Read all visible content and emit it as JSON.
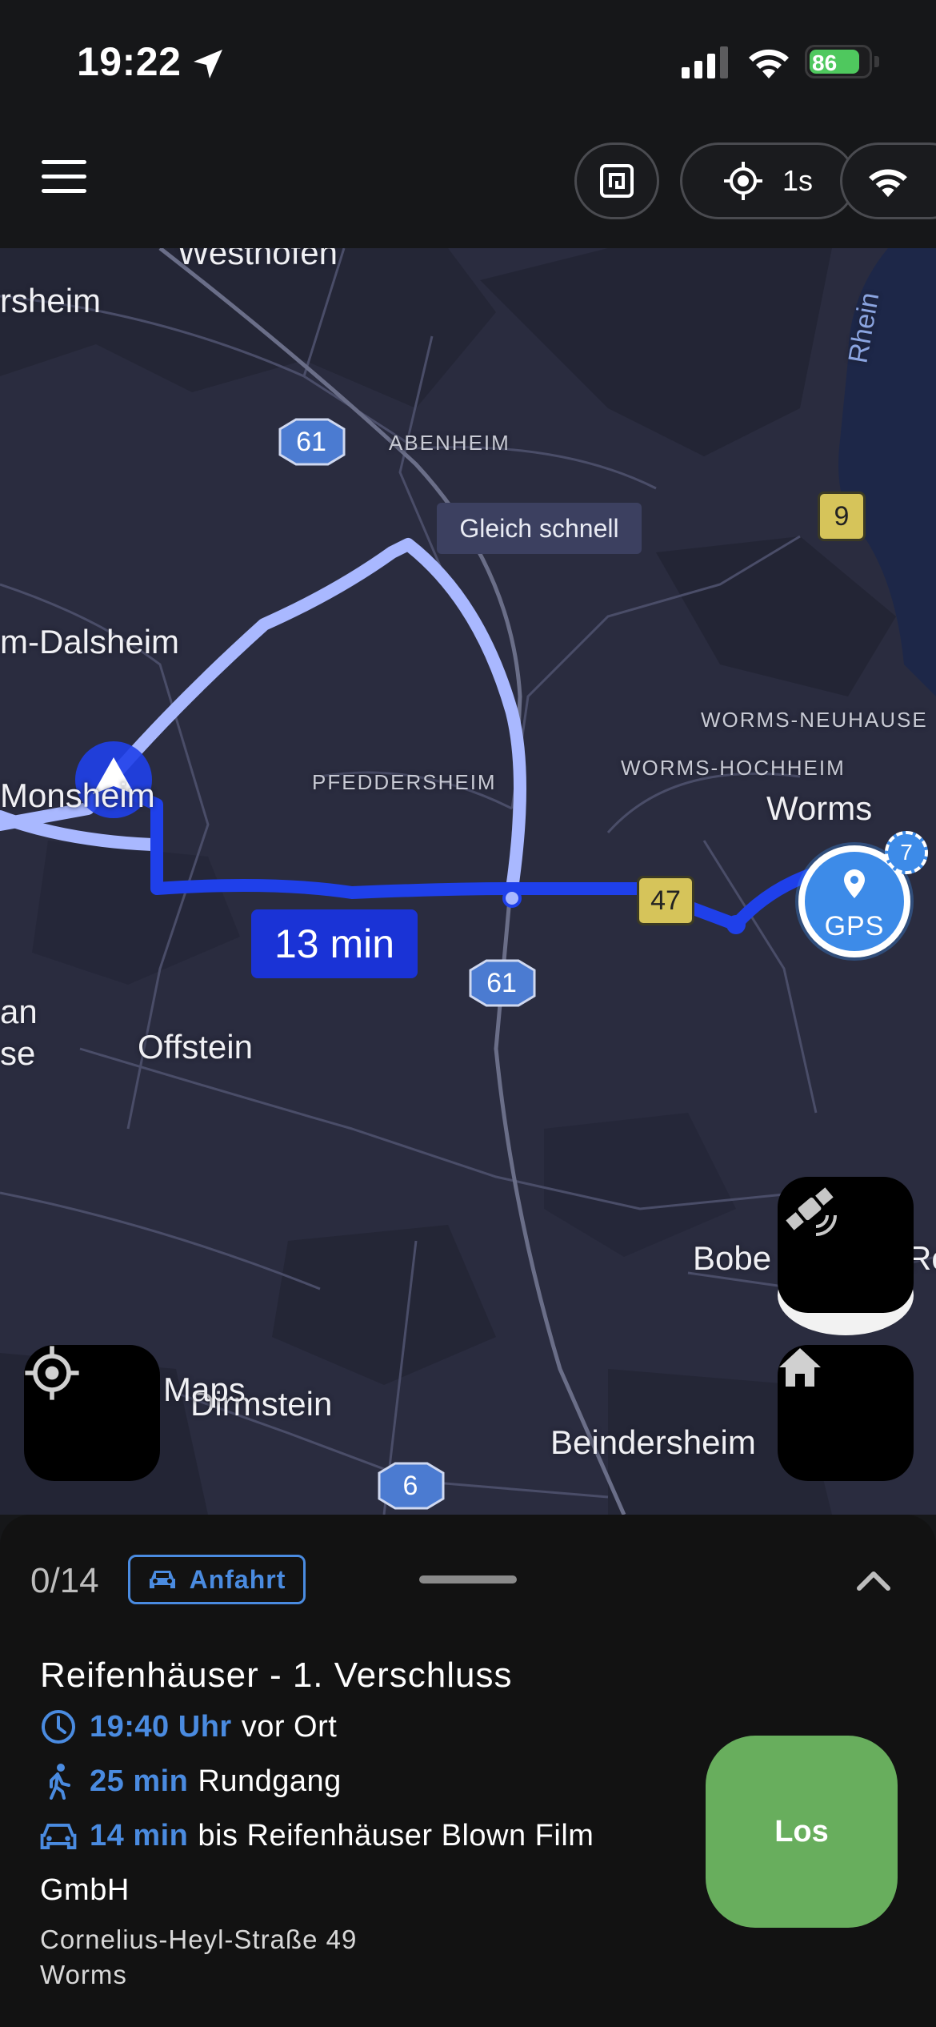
{
  "status_bar": {
    "time": "19:22",
    "battery": "86",
    "battery_level": 0.86,
    "colors": {
      "battery_fill": "#4fc85e"
    }
  },
  "toolbar": {
    "location_interval": "1s"
  },
  "map": {
    "places": {
      "westhofen": "Westhofen",
      "osthofen_partial": "rsheim",
      "abenheim": "ABENHEIM",
      "dalsheim": "m-Dalsheim",
      "monsheim": "Monsheim",
      "pfeddersheim": "PFEDDERSHEIM",
      "worms_neuhausen": "WORMS-NEUHAUSE",
      "worms_hochheim": "WORMS-HOCHHEIM",
      "worms": "Worms",
      "offstein": "Offstein",
      "partial_left_1": "an",
      "partial_left_2": "se",
      "bobenheim": "Bobe",
      "roxheim_partial": "Ro",
      "dirmstein": "Dirmstein",
      "beindersheim": "Beindersheim",
      "rhein": "Rhein",
      "maps_watermark": "Maps"
    },
    "road_shields": {
      "a61_top": "61",
      "a61_bottom": "61",
      "b9": "9",
      "b47": "47",
      "a6": "6"
    },
    "alt_route_callout": "Gleich schnell",
    "route_eta": "13 min",
    "gps_marker": "GPS",
    "gps_count": "7",
    "colors": {
      "route_primary": "#1f40ea",
      "route_alternative": "#a9b8ff",
      "gps_marker": "#3d8be8"
    }
  },
  "sheet": {
    "progress": "0/14",
    "mode_label": "Anfahrt",
    "stop_title": "Reifenhäuser - 1. Verschluss",
    "arrival_time": "19:40 Uhr",
    "arrival_suffix": "vor Ort",
    "walk_time": "25 min",
    "walk_suffix": "Rundgang",
    "drive_time": "14 min",
    "drive_suffix": "bis Reifenhäuser Blown Film",
    "drive_suffix_line2": "GmbH",
    "address_street": "Cornelius-Heyl-Straße 49",
    "address_city": "Worms",
    "go_label": "Los",
    "colors": {
      "accent": "#4a8be0",
      "go_button": "#68ae5d"
    }
  },
  "icons": {
    "status_location": "location-arrow-icon",
    "menu": "hamburger-menu-icon",
    "nfc": "nfc-tag-icon",
    "locate": "crosshair-icon",
    "wifi": "wifi-icon",
    "satellite": "satellite-icon",
    "home": "home-icon",
    "clock": "clock-icon",
    "walk": "walking-person-icon",
    "car": "car-icon",
    "chevron": "chevron-up-icon"
  }
}
